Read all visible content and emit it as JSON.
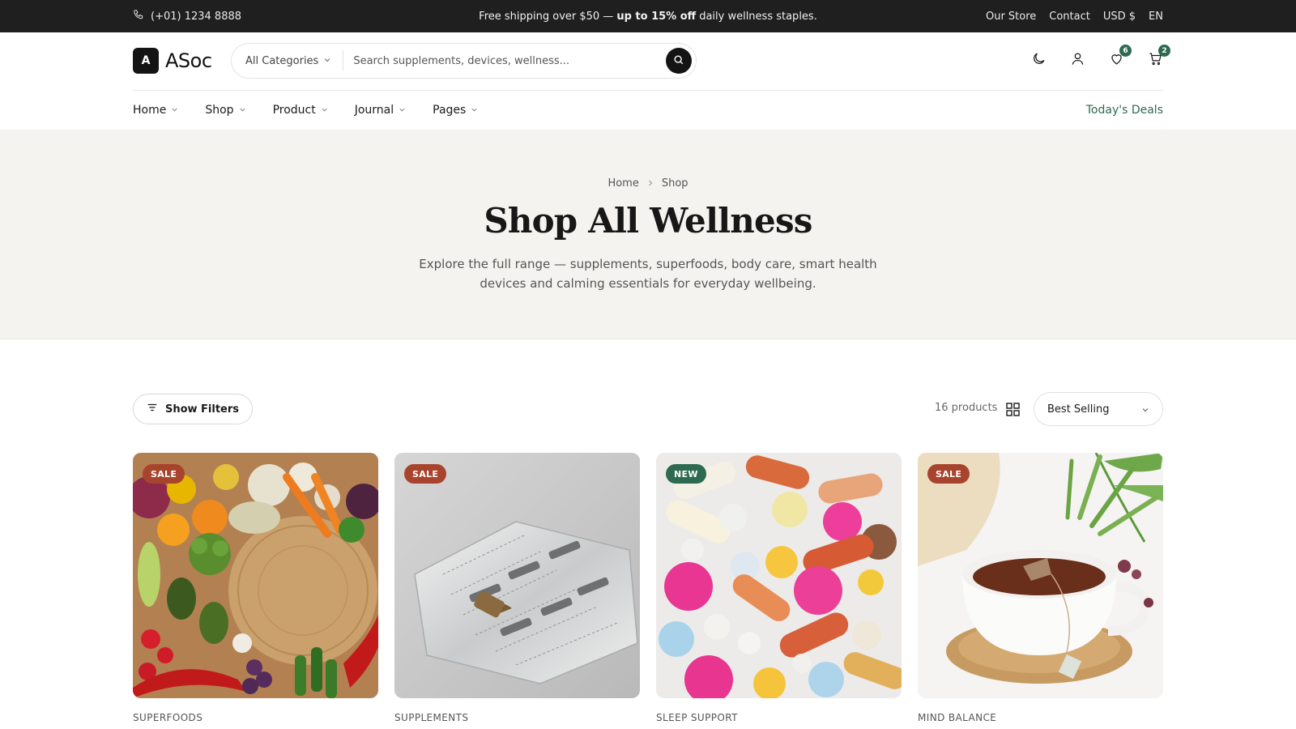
{
  "topbar": {
    "phone": "(+01) 1234 8888",
    "promo_pre": "Free shipping over $50 —",
    "promo_bold": "up to 15% off",
    "promo_post": "daily wellness staples.",
    "links": [
      "Our Store",
      "Contact",
      "USD $",
      "EN"
    ]
  },
  "header": {
    "logo_mark": "A",
    "logo_name": "ASoc",
    "category_label": "All Categories",
    "search_placeholder": "Search supplements, devices, wellness...",
    "wishlist_count": "6",
    "cart_count": "2"
  },
  "nav": {
    "items": [
      "Home",
      "Shop",
      "Product",
      "Journal",
      "Pages"
    ],
    "deals": "Today's Deals"
  },
  "hero": {
    "breadcrumb": [
      "Home",
      "Shop"
    ],
    "title": "Shop All Wellness",
    "subtitle": "Explore the full range — supplements, superfoods, body care, smart health devices and calming essentials for everyday wellbeing."
  },
  "toolbar": {
    "filters_label": "Show Filters",
    "count": "16 products",
    "sort_value": "Best Selling"
  },
  "products": [
    {
      "tag": "SALE",
      "tag_type": "sale",
      "category": "SUPERFOODS",
      "image": "vegetables-photo"
    },
    {
      "tag": "SALE",
      "tag_type": "sale",
      "category": "SUPPLEMENTS",
      "image": "capsule-blister-pack-photo"
    },
    {
      "tag": "NEW",
      "tag_type": "new",
      "category": "SLEEP SUPPORT",
      "image": "colorful-pills-photo"
    },
    {
      "tag": "SALE",
      "tag_type": "sale",
      "category": "MIND BALANCE",
      "image": "herbal-tea-cup-photo"
    }
  ],
  "colors": {
    "accent_green": "#2d6a4f",
    "sale_red": "#a8442d",
    "topbar_bg": "#1e1f1e",
    "hero_bg": "#f4f3ef"
  }
}
